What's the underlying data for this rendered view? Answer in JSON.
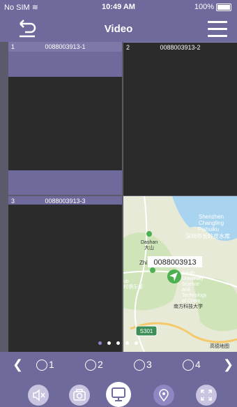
{
  "status_bar": {
    "carrier": "No SIM",
    "time": "10:49 AM",
    "battery": "100%"
  },
  "nav": {
    "title": "Video"
  },
  "cells": [
    {
      "num": "1",
      "title": "0088003913-1"
    },
    {
      "num": "2",
      "title": "0088003913-2"
    },
    {
      "num": "3",
      "title": "0088003913-3"
    }
  ],
  "map": {
    "device_label": "0088003913",
    "labels": [
      {
        "text": "Shenzhen"
      },
      {
        "text": "Changling"
      },
      {
        "text": "Pishuiku"
      },
      {
        "text": "深圳市长岭皮水库"
      },
      {
        "text": "Dashan"
      },
      {
        "text": "大山"
      },
      {
        "text": "Zhi"
      },
      {
        "text": "South"
      },
      {
        "text": "University"
      },
      {
        "text": "Science"
      },
      {
        "text": "and"
      },
      {
        "text": "Technology"
      },
      {
        "text": "of China"
      },
      {
        "text": "南方科技大学"
      },
      {
        "text": "ub"
      },
      {
        "text": "村俱乐部"
      },
      {
        "text": "S301"
      },
      {
        "text": "高德地图"
      }
    ]
  },
  "pager": {
    "options": [
      "1",
      "2",
      "3",
      "4"
    ]
  },
  "toolbar": {
    "icons": [
      "mute-icon",
      "camera-icon",
      "monitor-icon",
      "location-icon",
      "fullscreen-icon"
    ]
  }
}
